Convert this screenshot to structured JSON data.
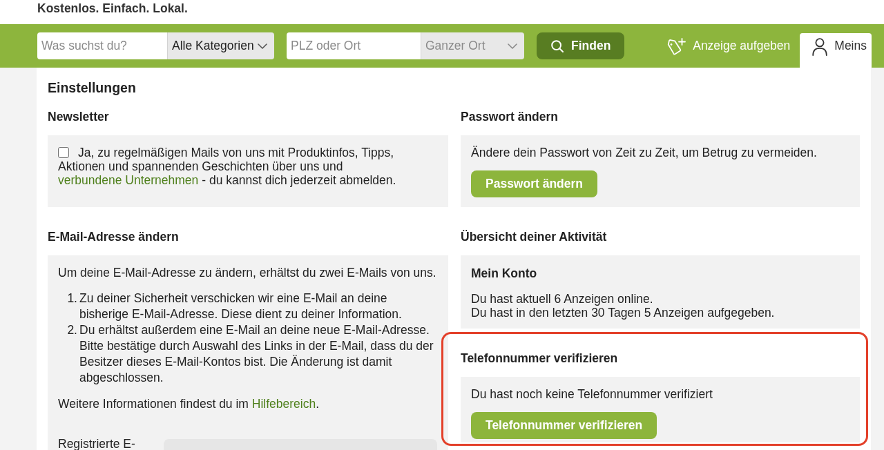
{
  "tagline": "Kostenlos. Einfach. Lokal.",
  "search": {
    "query": {
      "placeholder": "Was suchst du?"
    },
    "category": {
      "value": "Alle Kategorien",
      "disabled": false
    },
    "location": {
      "placeholder": "PLZ oder Ort"
    },
    "radius": {
      "value": "Ganzer Ort",
      "disabled": true
    },
    "submit": "Finden"
  },
  "nav": [
    {
      "kind": "post",
      "label": "Anzeige aufgeben",
      "selected": false
    },
    {
      "kind": "account",
      "label": "Meins",
      "selected": true
    }
  ],
  "page_title": "Einstellungen",
  "columns": [
    {
      "sections": [
        {
          "kind": "consent",
          "title": "Newsletter",
          "highlighted": false,
          "checked": false,
          "text": "Ja, zu regelmäßigen Mails von uns mit Produktinfos, Tipps, Aktionen und spannenden Geschichten über uns und",
          "link": "verbundene Unternehmen",
          "text_after": "- du kannst dich jederzeit abmelden."
        },
        {
          "kind": "steps",
          "title": "E-Mail-Adresse ändern",
          "highlighted": false,
          "intro": "Um deine E-Mail-Adresse zu ändern, erhältst du zwei E-Mails von uns.",
          "steps": [
            {
              "number": "1.",
              "text": "Zu deiner Sicherheit verschicken wir eine E-Mail an deine bisherige E-Mail-Adresse. Diese dient zu deiner Information."
            },
            {
              "number": "2.",
              "text": "Du erhältst außerdem eine E-Mail an deine neue E-Mail-Adresse. Bitte bestätige durch Auswahl des Links in der E-Mail, dass du der Besitzer dieses E-Mail-Kontos bist. Die Änderung ist damit abgeschlossen."
            }
          ],
          "info": "Weitere Informationen findest du im",
          "link": "Hilfebereich",
          "info_after": ".",
          "field": {
            "label": "Registrierte E-"
          }
        }
      ]
    },
    {
      "sections": [
        {
          "kind": "action",
          "title": "Passwort ändern",
          "highlighted": false,
          "text": "Ändere dein Passwort von Zeit zu Zeit, um Betrug zu vermeiden.",
          "button": "Passwort ändern"
        },
        {
          "kind": "summary",
          "title": "Übersicht deiner Aktivität",
          "highlighted": false,
          "subtitle": "Mein Konto",
          "lines": [
            "Du hast aktuell 6 Anzeigen online.",
            "Du hast in den letzten 30 Tagen 5 Anzeigen aufgegeben."
          ]
        },
        {
          "kind": "action",
          "title": "Telefonnummer verifizieren",
          "highlighted": true,
          "text": "Du hast noch keine Telefonnummer verifiziert",
          "button": "Telefonnummer verifizieren"
        }
      ]
    }
  ]
}
